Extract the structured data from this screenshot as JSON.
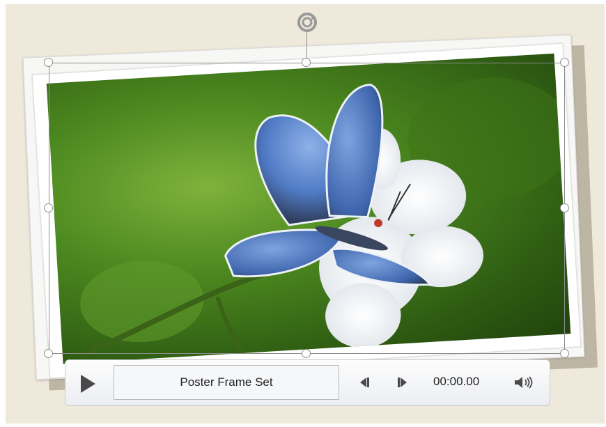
{
  "media_controls": {
    "status_text": "Poster Frame Set",
    "time": "00:00.00"
  },
  "icons": {
    "play": "play-icon",
    "step_back": "step-back-icon",
    "step_forward": "step-forward-icon",
    "volume": "volume-icon",
    "rotate": "rotate-icon"
  },
  "colors": {
    "slide_background": "#efe9dc",
    "selection_handle": "#8d8d8d",
    "control_bar": "#eceef2"
  }
}
